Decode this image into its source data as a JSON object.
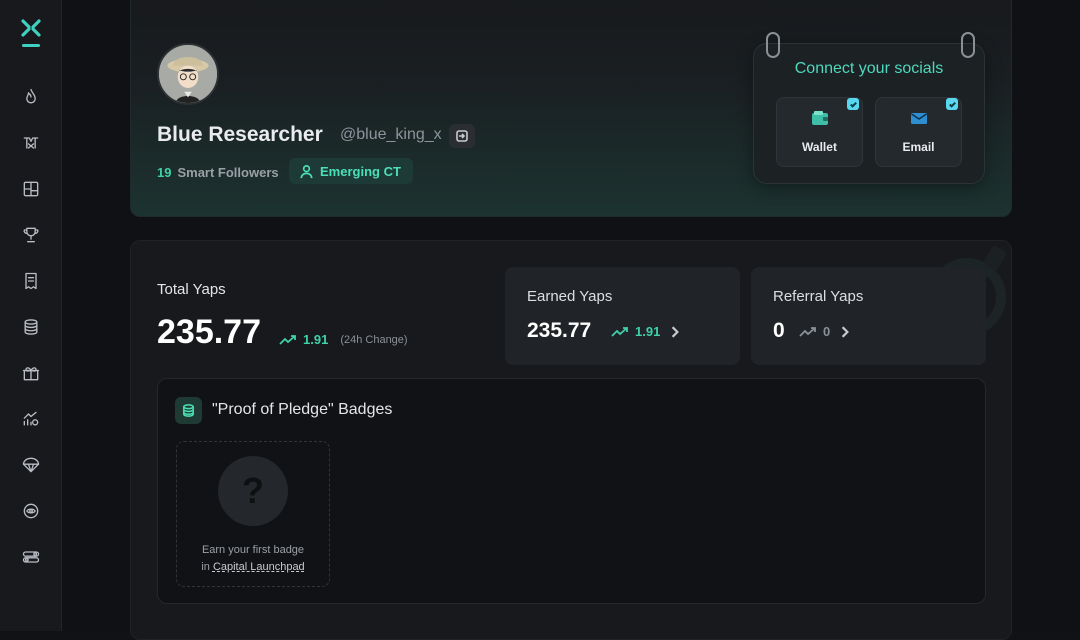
{
  "sidebar": {
    "logo": "x-logo",
    "items": [
      {
        "name": "fire-icon"
      },
      {
        "name": "mindshare-icon"
      },
      {
        "name": "dashboard-icon"
      },
      {
        "name": "trophy-icon"
      },
      {
        "name": "document-icon"
      },
      {
        "name": "coins-icon"
      },
      {
        "name": "gift-icon"
      },
      {
        "name": "chart-icon"
      },
      {
        "name": "parachute-icon"
      },
      {
        "name": "eye-icon"
      },
      {
        "name": "settings-icon"
      }
    ]
  },
  "profile": {
    "name": "Blue Researcher",
    "handle": "@blue_king_x",
    "followers_count": "19",
    "followers_label": "Smart Followers",
    "tag": "Emerging CT"
  },
  "socials": {
    "title": "Connect your socials",
    "wallet_label": "Wallet",
    "email_label": "Email"
  },
  "stats": {
    "total_label": "Total Yaps",
    "total_value": "235.77",
    "total_change": "1.91",
    "total_change_note": "(24h Change)",
    "earned_label": "Earned Yaps",
    "earned_value": "235.77",
    "earned_change": "1.91",
    "referral_label": "Referral Yaps",
    "referral_value": "0",
    "referral_change": "0"
  },
  "badges": {
    "title": "\"Proof of Pledge\" Badges",
    "placeholder_symbol": "?",
    "earn_line1": "Earn your first badge",
    "earn_line2_prefix": "in ",
    "earn_link": "Capital Launchpad"
  },
  "colors": {
    "accent": "#3fd1a8",
    "socials_title": "#4fd8be",
    "check": "#5ad7f0",
    "background": "#101114"
  }
}
